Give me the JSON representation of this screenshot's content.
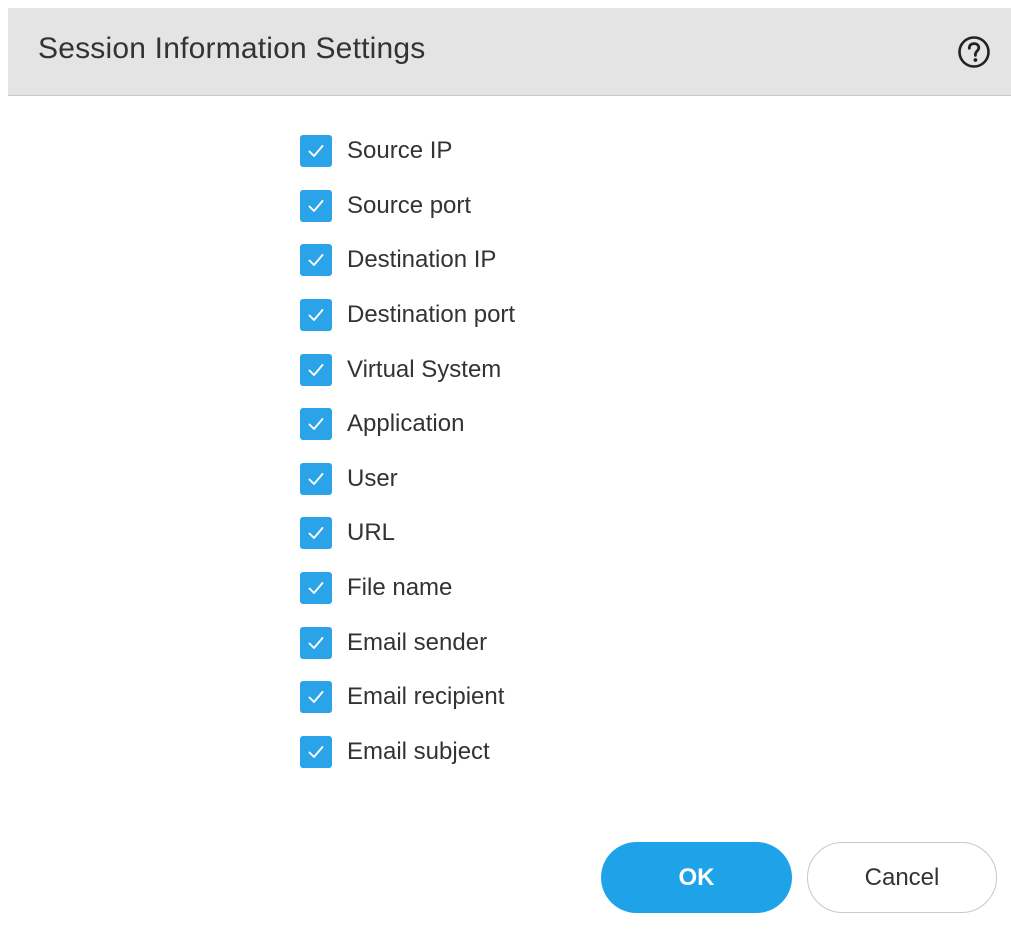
{
  "dialog": {
    "title": "Session Information Settings",
    "help_icon": "question-circle-icon"
  },
  "checkboxes": [
    {
      "label": "Source IP",
      "checked": true
    },
    {
      "label": "Source port",
      "checked": true
    },
    {
      "label": "Destination IP",
      "checked": true
    },
    {
      "label": "Destination port",
      "checked": true
    },
    {
      "label": "Virtual System",
      "checked": true
    },
    {
      "label": "Application",
      "checked": true
    },
    {
      "label": "User",
      "checked": true
    },
    {
      "label": "URL",
      "checked": true
    },
    {
      "label": "File name",
      "checked": true
    },
    {
      "label": "Email sender",
      "checked": true
    },
    {
      "label": "Email recipient",
      "checked": true
    },
    {
      "label": "Email subject",
      "checked": true
    }
  ],
  "buttons": {
    "ok_label": "OK",
    "cancel_label": "Cancel"
  },
  "colors": {
    "header_bg": "#e4e4e4",
    "checkbox_accent": "#2aa3e8",
    "primary_button": "#1ea3e8"
  }
}
